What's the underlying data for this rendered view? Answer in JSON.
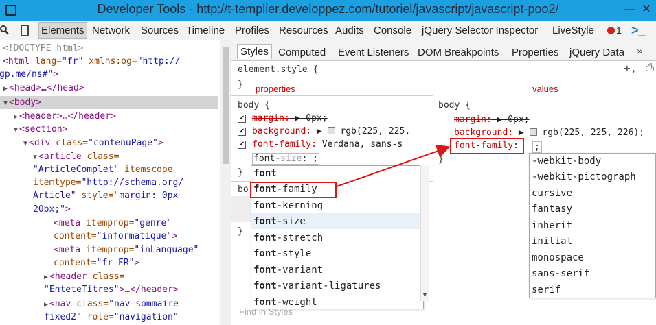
{
  "window": {
    "title": "Developer Tools - http://t-templier.developpez.com/tutoriel/javascript/javascript-poo2/",
    "minimize_glyph": "—",
    "close_glyph": "✕"
  },
  "toolbar": {
    "search_icon": "search-icon",
    "device_icon": "device-icon",
    "tabs": [
      "Elements",
      "Network",
      "Sources",
      "Timeline",
      "Profiles",
      "Resources",
      "Audits",
      "Console",
      "jQuery Selector Inspector",
      "LiveStyle"
    ],
    "error_count": "1",
    "console_glyph": ">_"
  },
  "dom_tree": {
    "lines": [
      {
        "tag": "<!DOCTYPE html>"
      },
      {
        "open": "<html",
        "attr": " lang=",
        "val": "\"fr\"",
        "attr2": " xmlns:og=",
        "val2": "\"http://"
      },
      {
        "val": "gp.me/ns#\"",
        "close": ">"
      },
      {
        "text": "<head>…</head>"
      },
      {
        "text": "<body>"
      },
      {
        "text": "<header>…</header>"
      },
      {
        "text": "<section>"
      },
      {
        "open": "<div",
        "attr": " class=",
        "val": "\"contenuPage\"",
        "close": ">"
      },
      {
        "open": "<article",
        "attr": " class="
      },
      {
        "val": "\"ArticleComplet\"",
        "attr": " itemscope"
      },
      {
        "attr": "itemtype=",
        "val": "\"http://schema.org/"
      },
      {
        "val": "Article\"",
        "attr": " style=",
        "val2": "\"margin: 0px"
      },
      {
        "val": "20px;\"",
        "close": ">"
      },
      {
        "open": "<meta",
        "attr": " itemprop=",
        "val": "\"genre\""
      },
      {
        "attr": "content=",
        "val": "\"informatique\"",
        "close": ">"
      },
      {
        "open": "<meta",
        "attr": " itemprop=",
        "val": "\"inLanguage\""
      },
      {
        "attr": "content=",
        "val": "\"fr-FR\"",
        "close": ">"
      },
      {
        "open": "<header",
        "attr": " class="
      },
      {
        "val": "\"EnteteTitres\"",
        "close": ">…</header>"
      },
      {
        "open": "<nav",
        "attr": " class=",
        "val": "\"nav-sommaire"
      },
      {
        "val": "fixed2\"",
        "attr": " role=",
        "val2": "\"navigation\""
      }
    ]
  },
  "styles_tabs": [
    "Styles",
    "Computed",
    "Event Listeners",
    "DOM Breakpoints",
    "Properties",
    "jQuery Data",
    "»"
  ],
  "styles": {
    "element_style": "element.style {",
    "close_brace": "}",
    "add_rule_glyph": "+,",
    "print_glyph": "⎙",
    "annot_properties": "properties",
    "annot_values": "values",
    "body_selector": "body {",
    "margin_prop": "margin:",
    "margin_val": "0px;",
    "background_prop": "background:",
    "background_val": "rgb(225, 225,",
    "background_val_full": "rgb(225, 225, 226);",
    "font_family_prop": "font-family:",
    "font_family_val": "Verdana, sans-s",
    "editing_prop_typed": "font",
    "editing_prop_suggest": "-size",
    "editing_rest": ": ;",
    "font_family_editing": "font-family",
    "colon_semicolon": ":",
    "value_cursor": ";",
    "second_block_prefix": "bo",
    "find_in_styles": "Find in Styles",
    "cut_text_1": "arg",
    "cut_text_2": "bo"
  },
  "prop_autocomplete": {
    "prefix": "font",
    "items": [
      "",
      "-family",
      "-kerning",
      "-size",
      "-stretch",
      "-style",
      "-variant",
      "-variant-ligatures",
      "-weight"
    ],
    "selected": "-size"
  },
  "value_autocomplete": {
    "items": [
      "-webkit-body",
      "-webkit-pictograph",
      "cursive",
      "fantasy",
      "inherit",
      "initial",
      "monospace",
      "sans-serif",
      "serif"
    ]
  },
  "colors": {
    "titlebar": "#1ba1e2",
    "annotation": "#d40000",
    "property": "#c80000",
    "tag": "#881280",
    "attr": "#994500",
    "value": "#1a1aa6"
  }
}
